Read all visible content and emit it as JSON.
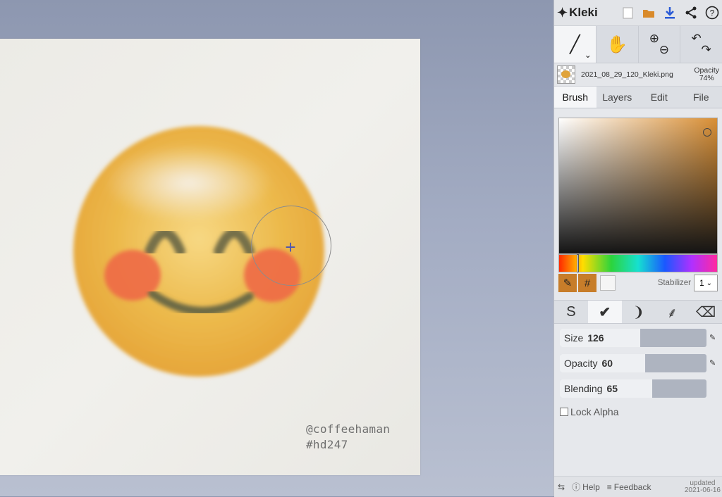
{
  "app": {
    "name": "Kleki"
  },
  "topbar": {
    "icons": [
      "new-file-icon",
      "open-folder-icon",
      "download-icon",
      "share-icon",
      "help-icon"
    ]
  },
  "file": {
    "name": "2021_08_29_120_Kleki.png",
    "opacity_label": "Opacity",
    "opacity_value": "74%"
  },
  "tabs": [
    {
      "label": "Brush",
      "active": true
    },
    {
      "label": "Layers",
      "active": false
    },
    {
      "label": "Edit",
      "active": false
    },
    {
      "label": "File",
      "active": false
    }
  ],
  "color": {
    "primary": "#c77d2a",
    "secondary": "#f5f5f5"
  },
  "stabilizer": {
    "label": "Stabilizer",
    "value": "1"
  },
  "sliders": {
    "size": {
      "label": "Size",
      "value": "126",
      "fraction": 0.55
    },
    "opacity": {
      "label": "Opacity",
      "value": "60",
      "fraction": 0.58
    },
    "blending": {
      "label": "Blending",
      "value": "65",
      "fraction": 0.63
    }
  },
  "lock_alpha": "Lock Alpha",
  "footer": {
    "help": "Help",
    "feedback": "Feedback",
    "updated_label": "updated",
    "updated_date": "2021-06-16"
  },
  "watermark": {
    "line1": "@coffeehaman",
    "line2": "#hd247"
  },
  "colors": {
    "face": "#e9b544",
    "blush": "#ee6a47",
    "features": "#6d6a45"
  }
}
